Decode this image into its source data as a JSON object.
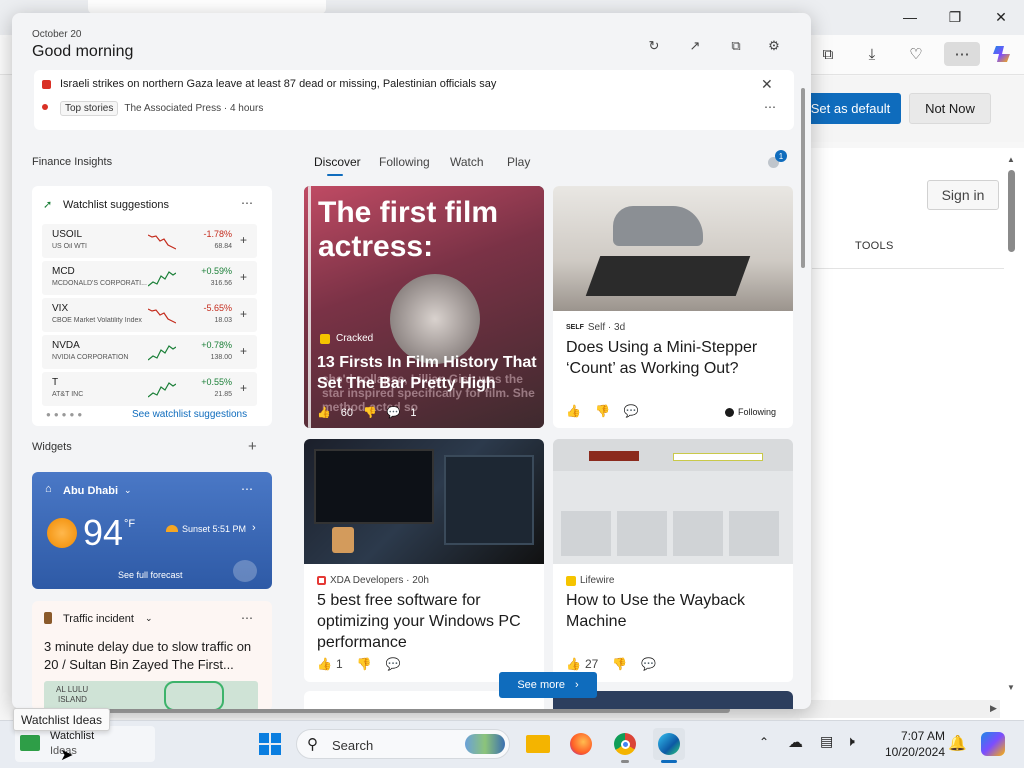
{
  "browser": {
    "default_bar": {
      "set_default_label": "Set as default",
      "not_now_label": "Not Now"
    },
    "signin_label": "Sign in",
    "tools_tab_label": "TOOLS"
  },
  "panel": {
    "date": "October 20",
    "greeting": "Good morning",
    "headline": {
      "text": "Israeli strikes on northern Gaza leave at least 87 dead or missing, Palestinian officials say",
      "tag": "Top stories",
      "source": "The Associated Press · 4 hours"
    },
    "finance_title": "Finance Insights",
    "watchlist": {
      "title": "Watchlist suggestions",
      "more_link": "See watchlist suggestions",
      "rows": [
        {
          "symbol": "USOIL",
          "name": "US Oil WTI",
          "change": "-1.78%",
          "price": "68.84",
          "up": false
        },
        {
          "symbol": "MCD",
          "name": "MCDONALD'S CORPORATI...",
          "change": "+0.59%",
          "price": "316.56",
          "up": true
        },
        {
          "symbol": "VIX",
          "name": "CBOE Market Volatility Index",
          "change": "-5.65%",
          "price": "18.03",
          "up": false
        },
        {
          "symbol": "NVDA",
          "name": "NVIDIA CORPORATION",
          "change": "+0.78%",
          "price": "138.00",
          "up": true
        },
        {
          "symbol": "T",
          "name": "AT&T INC",
          "change": "+0.55%",
          "price": "21.85",
          "up": true
        }
      ]
    },
    "widgets_title": "Widgets",
    "weather": {
      "city": "Abu Dhabi",
      "temp": "94",
      "unit": "°F",
      "sunset": "Sunset 5:51 PM",
      "forecast_link": "See full forecast"
    },
    "traffic": {
      "title": "Traffic incident",
      "text": "3 minute delay due to slow traffic on 20 / Sultan Bin Zayed The First...",
      "map_label_1": "AL LULU",
      "map_label_2": "ISLAND"
    },
    "tabs": [
      "Discover",
      "Following",
      "Watch",
      "Play"
    ],
    "notification_count": "1",
    "news": [
      {
        "source": "Cracked",
        "title": "13 Firsts In Film History That Set The Bar Pretty High",
        "likes": "60",
        "comments": "1",
        "overlay_top": "The first film actress:",
        "overlay_bottom": "she'd collapse, Lillian Gish was the star inspired specifically for film. She method-acted so"
      },
      {
        "source": "Self · 3d",
        "source_logo": "SELF",
        "title": "Does Using a Mini-Stepper ‘Count’ as Working Out?",
        "following": "Following"
      },
      {
        "source": "XDA Developers · 20h",
        "title": "5 best free software for optimizing your Windows PC performance",
        "likes": "1"
      },
      {
        "source": "Lifewire",
        "title": "How to Use the Wayback Machine",
        "likes": "27"
      }
    ],
    "see_more_label": "See more"
  },
  "tooltip": "Watchlist Ideas",
  "taskbar": {
    "widget_line1": "Watchlist",
    "widget_line2": "Ideas",
    "search_label": "Search",
    "time": "7:07 AM",
    "date": "10/20/2024"
  },
  "colors": {
    "accent": "#0f6cbd",
    "up": "#1a7f37",
    "down": "#c42b1c",
    "weather_bg": "#3a67b7"
  }
}
